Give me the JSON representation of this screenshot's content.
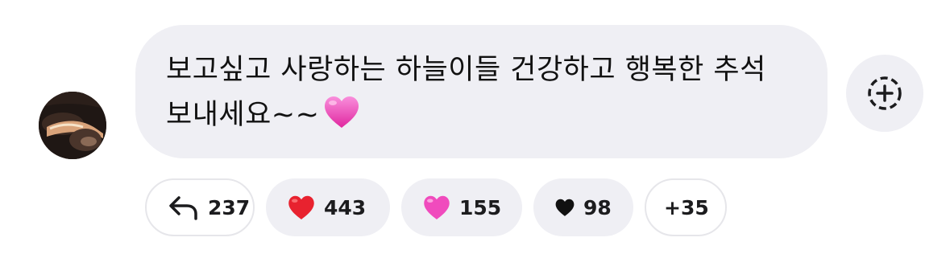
{
  "comment": {
    "text": "보고싶고 사랑하는 하늘이들 건강하고 행복한 추석 보내세요~~",
    "emoji": "pink-heart"
  },
  "reactions": [
    {
      "icon": "reply-icon",
      "count": "237"
    },
    {
      "icon": "red-heart-icon",
      "count": "443"
    },
    {
      "icon": "pink-heart-icon",
      "count": "155"
    },
    {
      "icon": "black-heart-icon",
      "count": "98"
    },
    {
      "icon": "",
      "count": "+35"
    }
  ],
  "colors": {
    "bubble": "#efeff4",
    "red_heart": "#e8222f",
    "pink_heart": "#f04bbd",
    "black_heart": "#111111"
  }
}
